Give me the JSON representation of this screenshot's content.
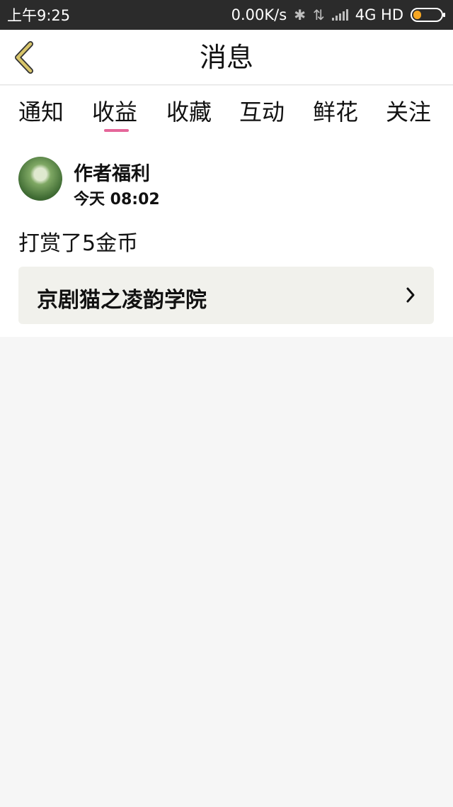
{
  "status_bar": {
    "time": "上午9:25",
    "speed": "0.00K/s",
    "bluetooth_icon": "bluetooth-icon",
    "data_icon": "data-transfer-icon",
    "signal_icon": "signal-icon",
    "network": "4G HD",
    "battery_level": 0.3,
    "battery_color": "#f5a623"
  },
  "header": {
    "title": "消息",
    "back_icon": "chevron-left-icon",
    "back_color": "#d8c56a"
  },
  "tabs": [
    {
      "label": "通知"
    },
    {
      "label": "收益",
      "active": true
    },
    {
      "label": "收藏"
    },
    {
      "label": "互动"
    },
    {
      "label": "鲜花"
    },
    {
      "label": "关注"
    }
  ],
  "tab_indicator_color": "#e5669a",
  "message": {
    "sender": "作者福利",
    "time": "今天 08:02",
    "body": "打赏了5金币",
    "linked_book": "京剧猫之凌韵学院",
    "chevron_icon": "chevron-right-icon"
  }
}
